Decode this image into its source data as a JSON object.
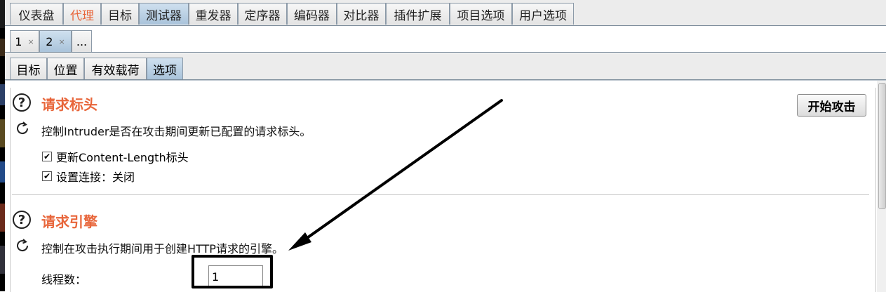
{
  "main_tabs": [
    "仪表盘",
    "代理",
    "目标",
    "测试器",
    "重发器",
    "定序器",
    "编码器",
    "对比器",
    "插件扩展",
    "项目选项",
    "用户选项"
  ],
  "active_main_tab": "测试器",
  "attack_tabs": [
    {
      "label": "1",
      "close": "×"
    },
    {
      "label": "2",
      "close": "×"
    },
    {
      "label": "...",
      "close": ""
    }
  ],
  "option_tabs": [
    "目标",
    "位置",
    "有效载荷",
    "选项"
  ],
  "active_option_tab": "选项",
  "start_attack_label": "开始攻击",
  "sections": {
    "request_headers": {
      "title": "请求标头",
      "description": "控制Intruder是否在攻击期间更新已配置的请求标头。",
      "options": [
        {
          "label": "更新Content-Length标头",
          "checked": true
        },
        {
          "label": "设置连接：关闭",
          "checked": true
        }
      ]
    },
    "request_engine": {
      "title": "请求引擎",
      "description": "控制在攻击执行期间用于创建HTTP请求的引擎。",
      "threads_label": "线程数：",
      "threads_value": "1"
    }
  },
  "colors": {
    "section_title": "#e8663b",
    "active_tab": "#b8cfe3",
    "annotation": "#000000"
  },
  "icons": [
    "help-icon",
    "refresh-icon",
    "checkbox-checked-icon",
    "close-icon"
  ]
}
